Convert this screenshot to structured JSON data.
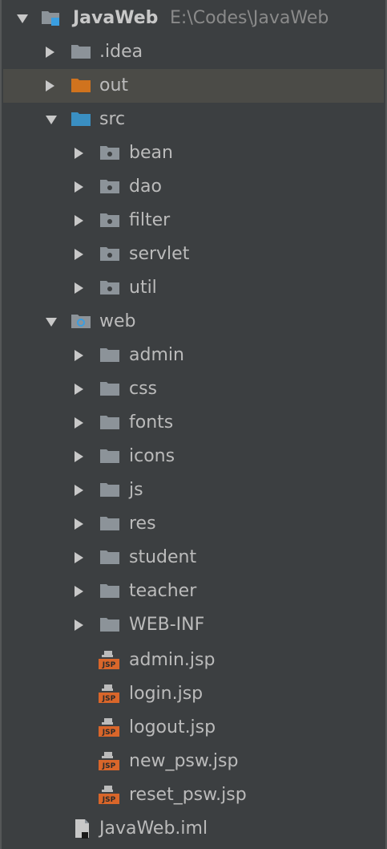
{
  "tree": {
    "root": {
      "label": "JavaWeb",
      "path": "E:\\Codes\\JavaWeb",
      "icon": "module-folder-icon"
    },
    "items": [
      {
        "label": ".idea",
        "icon": "folder-icon"
      },
      {
        "label": "out",
        "icon": "excluded-folder-icon"
      },
      {
        "label": "src",
        "icon": "source-folder-icon"
      },
      {
        "label": "bean",
        "icon": "package-icon"
      },
      {
        "label": "dao",
        "icon": "package-icon"
      },
      {
        "label": "filter",
        "icon": "package-icon"
      },
      {
        "label": "servlet",
        "icon": "package-icon"
      },
      {
        "label": "util",
        "icon": "package-icon"
      },
      {
        "label": "web",
        "icon": "web-folder-icon"
      },
      {
        "label": "admin",
        "icon": "folder-icon"
      },
      {
        "label": "css",
        "icon": "folder-icon"
      },
      {
        "label": "fonts",
        "icon": "folder-icon"
      },
      {
        "label": "icons",
        "icon": "folder-icon"
      },
      {
        "label": "js",
        "icon": "folder-icon"
      },
      {
        "label": "res",
        "icon": "folder-icon"
      },
      {
        "label": "student",
        "icon": "folder-icon"
      },
      {
        "label": "teacher",
        "icon": "folder-icon"
      },
      {
        "label": "WEB-INF",
        "icon": "folder-icon"
      },
      {
        "label": "admin.jsp",
        "icon": "jsp-file-icon"
      },
      {
        "label": "login.jsp",
        "icon": "jsp-file-icon"
      },
      {
        "label": "logout.jsp",
        "icon": "jsp-file-icon"
      },
      {
        "label": "new_psw.jsp",
        "icon": "jsp-file-icon"
      },
      {
        "label": "reset_psw.jsp",
        "icon": "jsp-file-icon"
      },
      {
        "label": "JavaWeb.iml",
        "icon": "iml-file-icon"
      }
    ]
  },
  "colors": {
    "background": "#3c3f41",
    "selection": "#4b4b47",
    "text": "#bbbbbb",
    "folder": "#8c9399",
    "excluded_folder": "#d0731e",
    "source_folder": "#3a8fc2",
    "jsp_orange": "#d9662a"
  }
}
